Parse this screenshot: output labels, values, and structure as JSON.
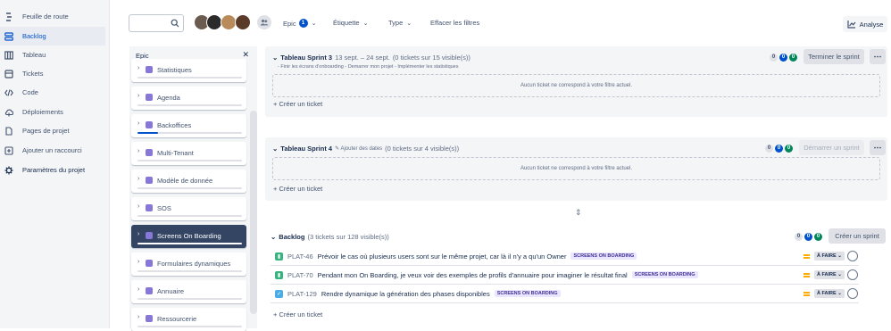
{
  "sidebar": {
    "items": [
      {
        "label": "Feuille de route",
        "icon": "roadmap-icon"
      },
      {
        "label": "Backlog",
        "icon": "backlog-icon",
        "active": true
      },
      {
        "label": "Tableau",
        "icon": "board-icon"
      },
      {
        "label": "Tickets",
        "icon": "tickets-icon"
      },
      {
        "label": "Code",
        "icon": "code-icon"
      },
      {
        "label": "Déploiements",
        "icon": "cloud-icon"
      },
      {
        "label": "Pages de projet",
        "icon": "page-icon"
      },
      {
        "label": "Ajouter un raccourci",
        "icon": "add-shortcut-icon"
      },
      {
        "label": "Paramètres du projet",
        "icon": "gear-icon"
      }
    ]
  },
  "toolbar": {
    "epic_label": "Epic",
    "epic_count": "1",
    "etiquette_label": "Étiquette",
    "type_label": "Type",
    "clear_filters": "Effacer les filtres",
    "analyse_label": "Analyse"
  },
  "epic_panel": {
    "title": "Epic",
    "items": [
      {
        "label": "Statistiques",
        "progress": 0
      },
      {
        "label": "Agenda",
        "progress": 0
      },
      {
        "label": "Backoffices",
        "progress": 0.2
      },
      {
        "label": "Multi-Tenant",
        "progress": 0
      },
      {
        "label": "Modèle de donnée",
        "progress": 0
      },
      {
        "label": "SOS",
        "progress": 0
      },
      {
        "label": "Screens On Boarding",
        "progress": 0,
        "selected": true
      },
      {
        "label": "Formulaires dynamiques",
        "progress": 0
      },
      {
        "label": "Annuaire",
        "progress": 0
      },
      {
        "label": "Ressourcerie",
        "progress": 0
      }
    ]
  },
  "sprint3": {
    "title": "Tableau Sprint 3",
    "dates": "13 sept. – 24 sept.",
    "count": "(0 tickets sur 15 visible(s))",
    "goal": "- Finir les écrans d'onboarding - Demarrer mon projet - Implémenter les statistiques",
    "counts": [
      "0",
      "0",
      "0"
    ],
    "empty": "Aucun ticket ne correspond à votre filtre actuel.",
    "action": "Terminer le sprint",
    "create": "Créer un ticket"
  },
  "sprint4": {
    "title": "Tableau Sprint 4",
    "add_dates": "Ajouter des dates",
    "count": "(0 tickets sur 4 visible(s))",
    "counts": [
      "0",
      "0",
      "0"
    ],
    "empty": "Aucun ticket ne correspond à votre filtre actuel.",
    "action": "Démarrer un sprint",
    "create": "Créer un ticket"
  },
  "backlog": {
    "title": "Backlog",
    "count": "(3 tickets sur 128 visible(s))",
    "counts": [
      "0",
      "0",
      "0"
    ],
    "action": "Créer un sprint",
    "create": "Créer un ticket",
    "issues": [
      {
        "key": "PLAT-46",
        "summary": "Prévoir le cas où plusieurs users sont sur le même projet, car là il n'y a qu'un Owner",
        "epic": "SCREENS ON BOARDING",
        "status": "À FAIRE",
        "type": "story"
      },
      {
        "key": "PLAT-70",
        "summary": "Pendant mon On Boarding, je veux voir des exemples de profils d'annuaire pour imaginer le résultat final",
        "epic": "SCREENS ON BOARDING",
        "status": "À FAIRE",
        "type": "story"
      },
      {
        "key": "PLAT-129",
        "summary": "Rendre dynamique la génération des phases disponibles",
        "epic": "SCREENS ON BOARDING",
        "status": "À FAIRE",
        "type": "task"
      }
    ]
  },
  "colors": {
    "accent": "#0052cc",
    "story": "#36b37e",
    "task": "#4bade8",
    "epic": "#8777d9",
    "priority": "#ffab00"
  }
}
